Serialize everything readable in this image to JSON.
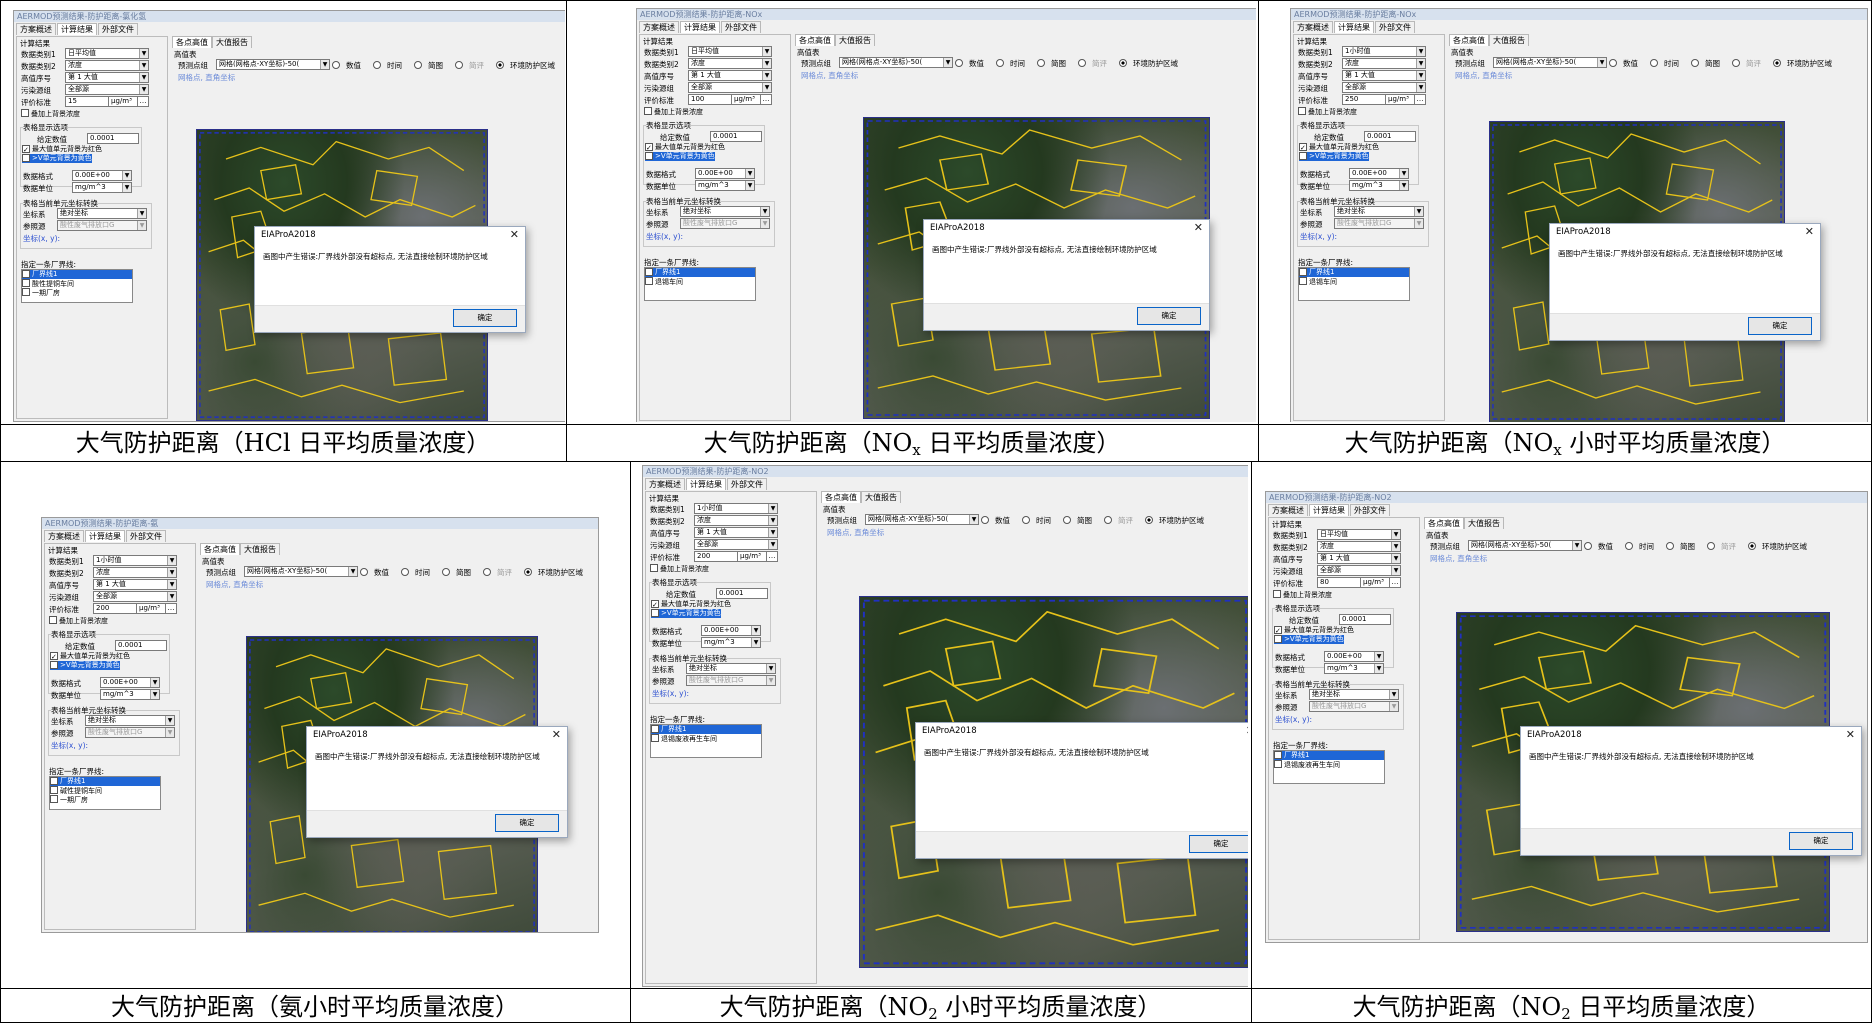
{
  "window": {
    "tabs": [
      "方案概述",
      "计算结果",
      "外部文件"
    ],
    "subtabs": [
      "各点高值",
      "大值报告"
    ],
    "left": {
      "group_title": "计算结果",
      "data_type1_label": "数据类别1",
      "data_type2_label": "数据类别2",
      "data_type2_value": "浓度",
      "rank_label": "高值序号",
      "rank_value": "第 1 大值",
      "source_group_label": "污染源组",
      "source_group_value": "全部源",
      "standard_label": "评价标准",
      "standard_unit": "μg/m³",
      "bg_check_label": "叠加上背景浓度",
      "table_group_title": "表格显示选项",
      "given_value_label": "给定数值",
      "given_value": "0.0001",
      "max_red_label": "最大值单元背景为红色",
      "over_yellow_label": ">V单元背景为黄色",
      "format_label": "数据格式",
      "format_value": "0.00E+00",
      "unit_label": "数据单位",
      "unit_value": "mg/m^3",
      "coord_group_title": "表格当前单元坐标转换",
      "coord_sys_label": "坐标系",
      "coord_sys_value": "绝对坐标",
      "ref_src_label": "参照源",
      "ref_src_value": "酸性废气排放口G",
      "coord_xy_label": "坐标(x, y):",
      "boundary_title": "指定一条厂界线:"
    },
    "right": {
      "table_label": "高值表",
      "predict_label": "预测点组",
      "predict_value": "网格(网格点-XY坐标)-50(",
      "radios": [
        "数值",
        "时间",
        "简图",
        "简评",
        "环境防护区域"
      ],
      "grid_info": "网格点, 直角坐标"
    },
    "dialog": {
      "title": "EIAProA2018",
      "close": "✕",
      "message": "画图中产生错误:厂界线外部没有超标点, 无法直接绘制环境防护区域",
      "ok": "确定"
    }
  },
  "panels": [
    {
      "window_title": "AERMOD预测结果-防护距离-氯化氢",
      "data_type1": "日平均值",
      "standard": "15",
      "boundaries": [
        "厂界线1",
        "酸性提铜车间",
        "一期厂房"
      ],
      "caption_pre": "大气防护距离（HCl 日平均质量浓度）",
      "caption_sub": "",
      "caption_post": ""
    },
    {
      "window_title": "AERMOD预测结果-防护距离-NOx",
      "data_type1": "日平均值",
      "standard": "100",
      "boundaries": [
        "厂界线1",
        "退锡车间"
      ],
      "caption_pre": "大气防护距离（NO",
      "caption_sub": "x",
      "caption_post": " 日平均质量浓度）"
    },
    {
      "window_title": "AERMOD预测结果-防护距离-NOx",
      "data_type1": "1小时值",
      "standard": "250",
      "boundaries": [
        "厂界线1",
        "退锡车间"
      ],
      "caption_pre": "大气防护距离（NO",
      "caption_sub": "x",
      "caption_post": " 小时平均质量浓度）"
    },
    {
      "window_title": "AERMOD预测结果-防护距离-氨",
      "data_type1": "1小时值",
      "standard": "200",
      "boundaries": [
        "厂界线1",
        "碱性提铜车间",
        "一期厂房"
      ],
      "caption_pre": "大气防护距离（氨小时平均质量浓度）",
      "caption_sub": "",
      "caption_post": ""
    },
    {
      "window_title": "AERMOD预测结果-防护距离-NO2",
      "data_type1": "1小时值",
      "standard": "200",
      "boundaries": [
        "厂界线1",
        "退锡废液再生车间"
      ],
      "caption_pre": "大气防护距离（NO",
      "caption_sub": "2",
      "caption_post": " 小时平均质量浓度）"
    },
    {
      "window_title": "AERMOD预测结果-防护距离-NO2",
      "data_type1": "日平均值",
      "standard": "80",
      "boundaries": [
        "厂界线1",
        "退锡废液再生车间"
      ],
      "caption_pre": "大气防护距离（NO",
      "caption_sub": "2",
      "caption_post": " 日平均质量浓度）"
    }
  ]
}
